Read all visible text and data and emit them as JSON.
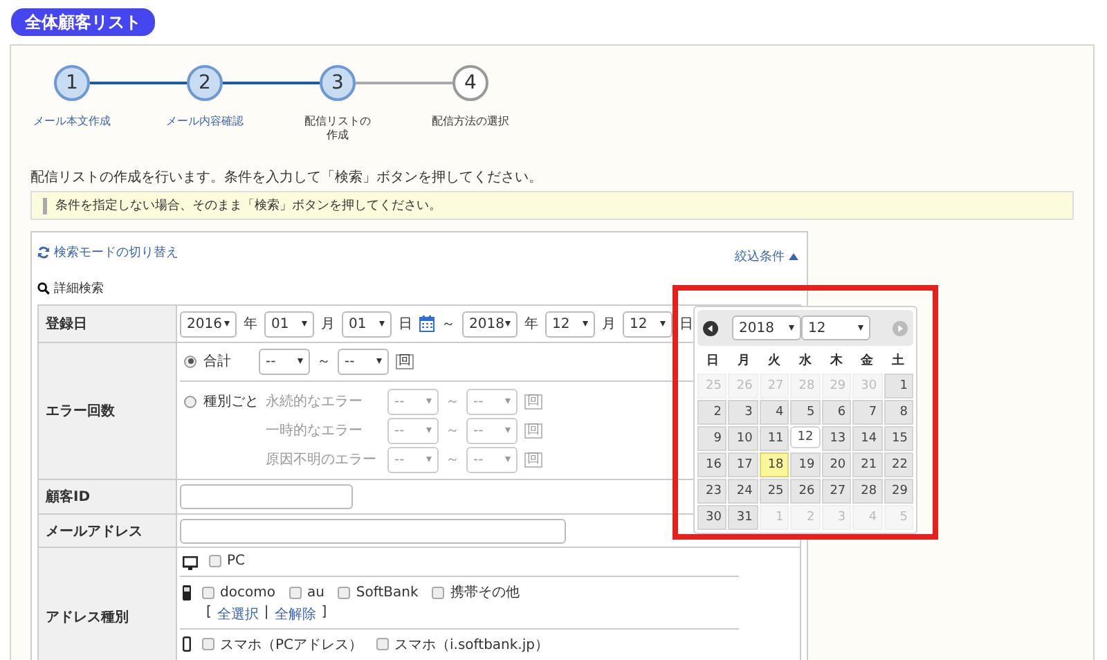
{
  "header": {
    "title": "全体顧客リスト"
  },
  "steps": [
    {
      "number": "1",
      "label": "メール本文作成",
      "completed": true,
      "selected": false
    },
    {
      "number": "2",
      "label": "メール内容確認",
      "completed": true,
      "selected": false
    },
    {
      "number": "3",
      "label": "配信リストの作成",
      "completed": false,
      "selected": true
    },
    {
      "number": "4",
      "label": "配信方法の選択",
      "completed": false,
      "selected": false
    }
  ],
  "instruction": "配信リストの作成を行います。条件を入力して「検索」ボタンを押してください。",
  "note": "条件を指定しない場合、そのまま「検索」ボタンを押してください。",
  "search": {
    "mode_toggle": "検索モードの切り替え",
    "filter_toggle": "絞込条件",
    "filter_expanded": true,
    "section_title": "詳細検索"
  },
  "registration_date": {
    "label": "登録日",
    "from": {
      "year": "2016",
      "year_unit": "年",
      "month": "01",
      "month_unit": "月",
      "day": "01",
      "day_unit": "日"
    },
    "range_sep": "～",
    "to": {
      "year": "2018",
      "year_unit": "年",
      "month": "12",
      "month_unit": "月",
      "day": "12",
      "day_unit": "日"
    }
  },
  "error_count": {
    "label": "エラー回数",
    "options": [
      {
        "label": "合計",
        "selected": true,
        "rows": [
          {
            "from": "--",
            "sep": "～",
            "to": "--",
            "unit": "回"
          }
        ]
      },
      {
        "label": "種別ごと",
        "selected": false,
        "rows": [
          {
            "name": "永続的なエラー",
            "from": "--",
            "sep": "～",
            "to": "--",
            "unit": "回"
          },
          {
            "name": "一時的なエラー",
            "from": "--",
            "sep": "～",
            "to": "--",
            "unit": "回"
          },
          {
            "name": "原因不明のエラー",
            "from": "--",
            "sep": "～",
            "to": "--",
            "unit": "回"
          }
        ]
      }
    ]
  },
  "customer_id": {
    "label": "顧客ID"
  },
  "email": {
    "label": "メールアドレス"
  },
  "address_type": {
    "label": "アドレス種別",
    "groups": [
      {
        "kind": "pc",
        "options": [
          {
            "label": "PC",
            "checked": false
          }
        ]
      },
      {
        "kind": "mobile",
        "options": [
          {
            "label": "docomo",
            "checked": false
          },
          {
            "label": "au",
            "checked": false
          },
          {
            "label": "SoftBank",
            "checked": false
          },
          {
            "label": "携帯その他",
            "checked": false
          }
        ],
        "links": {
          "open": "[",
          "items": [
            "全選択",
            "全解除"
          ],
          "separator": "|",
          "close": "]"
        }
      },
      {
        "kind": "smartphone",
        "options": [
          {
            "label": "スマホ（PCアドレス）",
            "checked": false
          },
          {
            "label": "スマホ（i.softbank.jp）",
            "checked": false
          }
        ]
      }
    ]
  },
  "calendar": {
    "highlighted": true,
    "year": "2018",
    "month": "12",
    "weekdays": [
      "日",
      "月",
      "火",
      "水",
      "木",
      "金",
      "土"
    ],
    "weeks": [
      [
        {
          "day": "25",
          "other_month": true,
          "today": false,
          "selected": false
        },
        {
          "day": "26",
          "other_month": true,
          "today": false,
          "selected": false
        },
        {
          "day": "27",
          "other_month": true,
          "today": false,
          "selected": false
        },
        {
          "day": "28",
          "other_month": true,
          "today": false,
          "selected": false
        },
        {
          "day": "29",
          "other_month": true,
          "today": false,
          "selected": false
        },
        {
          "day": "30",
          "other_month": true,
          "today": false,
          "selected": false
        },
        {
          "day": "1",
          "other_month": false,
          "today": false,
          "selected": false
        }
      ],
      [
        {
          "day": "2",
          "other_month": false,
          "today": false,
          "selected": false
        },
        {
          "day": "3",
          "other_month": false,
          "today": false,
          "selected": false
        },
        {
          "day": "4",
          "other_month": false,
          "today": false,
          "selected": false
        },
        {
          "day": "5",
          "other_month": false,
          "today": false,
          "selected": false
        },
        {
          "day": "6",
          "other_month": false,
          "today": false,
          "selected": false
        },
        {
          "day": "7",
          "other_month": false,
          "today": false,
          "selected": false
        },
        {
          "day": "8",
          "other_month": false,
          "today": false,
          "selected": false
        }
      ],
      [
        {
          "day": "9",
          "other_month": false,
          "today": false,
          "selected": false
        },
        {
          "day": "10",
          "other_month": false,
          "today": false,
          "selected": false
        },
        {
          "day": "11",
          "other_month": false,
          "today": false,
          "selected": false
        },
        {
          "day": "12",
          "other_month": false,
          "today": false,
          "selected": true
        },
        {
          "day": "13",
          "other_month": false,
          "today": false,
          "selected": false
        },
        {
          "day": "14",
          "other_month": false,
          "today": false,
          "selected": false
        },
        {
          "day": "15",
          "other_month": false,
          "today": false,
          "selected": false
        }
      ],
      [
        {
          "day": "16",
          "other_month": false,
          "today": false,
          "selected": false
        },
        {
          "day": "17",
          "other_month": false,
          "today": false,
          "selected": false
        },
        {
          "day": "18",
          "other_month": false,
          "today": true,
          "selected": false
        },
        {
          "day": "19",
          "other_month": false,
          "today": false,
          "selected": false
        },
        {
          "day": "20",
          "other_month": false,
          "today": false,
          "selected": false
        },
        {
          "day": "21",
          "other_month": false,
          "today": false,
          "selected": false
        },
        {
          "day": "22",
          "other_month": false,
          "today": false,
          "selected": false
        }
      ],
      [
        {
          "day": "23",
          "other_month": false,
          "today": false,
          "selected": false
        },
        {
          "day": "24",
          "other_month": false,
          "today": false,
          "selected": false
        },
        {
          "day": "25",
          "other_month": false,
          "today": false,
          "selected": false
        },
        {
          "day": "26",
          "other_month": false,
          "today": false,
          "selected": false
        },
        {
          "day": "27",
          "other_month": false,
          "today": false,
          "selected": false
        },
        {
          "day": "28",
          "other_month": false,
          "today": false,
          "selected": false
        },
        {
          "day": "29",
          "other_month": false,
          "today": false,
          "selected": false
        }
      ],
      [
        {
          "day": "30",
          "other_month": false,
          "today": false,
          "selected": false
        },
        {
          "day": "31",
          "other_month": false,
          "today": false,
          "selected": false
        },
        {
          "day": "1",
          "other_month": true,
          "today": false,
          "selected": false
        },
        {
          "day": "2",
          "other_month": true,
          "today": false,
          "selected": false
        },
        {
          "day": "3",
          "other_month": true,
          "today": false,
          "selected": false
        },
        {
          "day": "4",
          "other_month": true,
          "today": false,
          "selected": false
        },
        {
          "day": "5",
          "other_month": true,
          "today": false,
          "selected": false
        }
      ]
    ]
  }
}
